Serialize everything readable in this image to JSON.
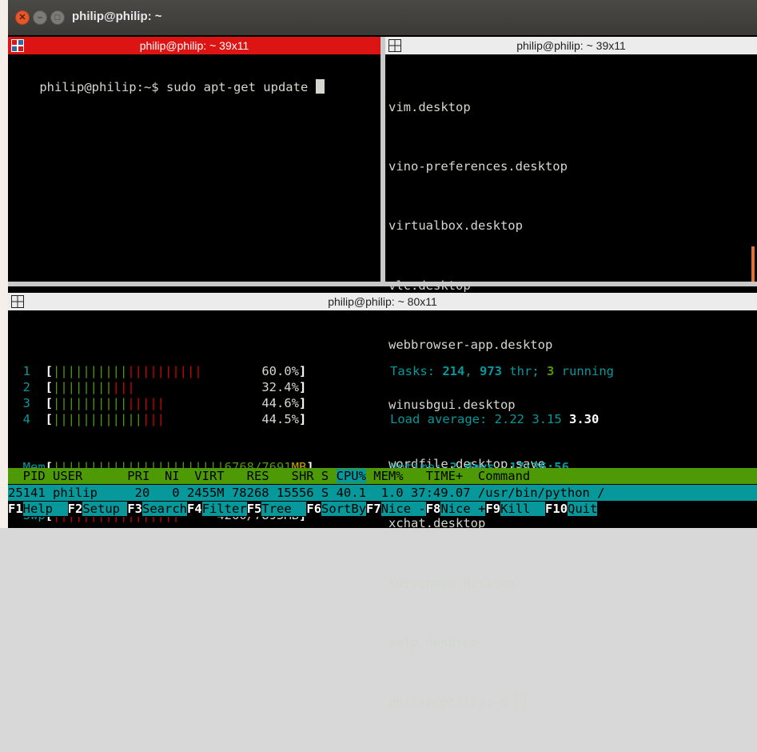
{
  "window": {
    "title": "philip@philip: ~"
  },
  "panes": {
    "top_left": {
      "header": "philip@philip: ~ 39x11",
      "prompt": "philip@philip:~$ sudo apt-get update "
    },
    "top_right": {
      "header": "philip@philip: ~ 39x11",
      "lines": [
        "vim.desktop",
        "vino-preferences.desktop",
        "virtualbox.desktop",
        "vlc.desktop",
        "webbrowser-app.desktop",
        "winusbgui.desktop",
        "wordfile.desktop.save",
        "xchat.desktop",
        "xdiagnose.desktop",
        "yelp.desktop"
      ],
      "prompt": "philip@philip:~$ "
    },
    "bottom": {
      "header": "philip@philip: ~ 80x11"
    }
  },
  "htop": {
    "cpus": [
      {
        "num": "1",
        "pct": "60.0%",
        "green": 10,
        "red": 10
      },
      {
        "num": "2",
        "pct": "32.4%",
        "green": 8,
        "red": 3
      },
      {
        "num": "3",
        "pct": "44.6%",
        "green": 10,
        "red": 5
      },
      {
        "num": "4",
        "pct": "44.5%",
        "green": 12,
        "red": 3
      }
    ],
    "mem": {
      "label": "Mem",
      "used": "6768",
      "total": "/7691",
      "unit": "MB",
      "bars": 23
    },
    "swp": {
      "label": "Swp",
      "value": "4260/7895MB",
      "bars": 17
    },
    "tasks": {
      "label": "Tasks: ",
      "tasks": "214",
      "sep1": ", ",
      "thr": "973",
      "thr_label": " thr; ",
      "running": "3",
      "running_label": " running"
    },
    "load": {
      "label": "Load average: ",
      "v1": "2.22",
      "v2": "3.15",
      "v3": "3.30"
    },
    "uptime": {
      "label": "Uptime: ",
      "value": "2 days, 17:36:56"
    },
    "header": {
      "pre": "  PID USER      PRI  NI  VIRT   RES   SHR S ",
      "cpu": "CPU%",
      "post": " MEM%   TIME+  Command"
    },
    "row": "25141 philip     20   0 2455M 78268 15556 S 40.1  1.0 37:49.07 /usr/bin/python /",
    "fkeys": [
      {
        "key": "F1",
        "label": "Help  "
      },
      {
        "key": "F2",
        "label": "Setup "
      },
      {
        "key": "F3",
        "label": "Search"
      },
      {
        "key": "F4",
        "label": "Filter"
      },
      {
        "key": "F5",
        "label": "Tree  "
      },
      {
        "key": "F6",
        "label": "SortBy"
      },
      {
        "key": "F7",
        "label": "Nice -"
      },
      {
        "key": "F8",
        "label": "Nice +"
      },
      {
        "key": "F9",
        "label": "Kill  "
      },
      {
        "key": "F10",
        "label": "Quit"
      }
    ]
  }
}
